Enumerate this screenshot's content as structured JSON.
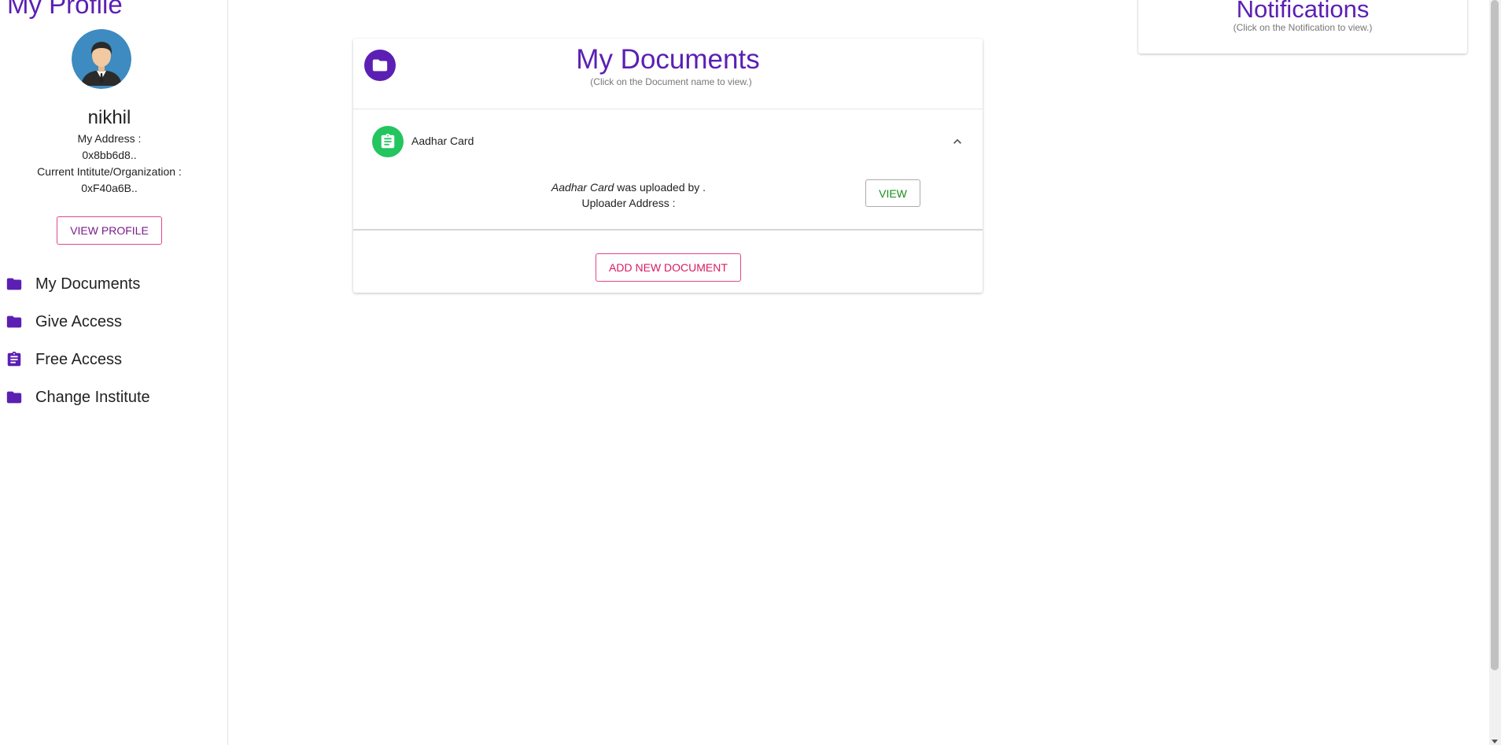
{
  "sidebar": {
    "title": "My Profile",
    "username": "nikhil",
    "address_label": "My Address :",
    "address_value": "0x8bb6d8..",
    "institute_label": "Current Intitute/Organization :",
    "institute_value": "0xF40a6B..",
    "view_profile_label": "VIEW PROFILE",
    "nav_items": [
      {
        "label": "My Documents",
        "icon": "folder-icon"
      },
      {
        "label": "Give Access",
        "icon": "folder-icon"
      },
      {
        "label": "Free Access",
        "icon": "clipboard-icon"
      },
      {
        "label": "Change Institute",
        "icon": "folder-icon"
      }
    ]
  },
  "main": {
    "title": "My Documents",
    "subtitle": "(Click on the Document name to view.)",
    "documents": [
      {
        "name": "Aadhar Card",
        "name_italic": "Aadhar Card",
        "uploaded_by_text": " was uploaded by .",
        "uploader_address_label": "Uploader Address :",
        "view_label": "VIEW"
      }
    ],
    "add_document_label": "ADD NEW DOCUMENT"
  },
  "notifications": {
    "title": "Notifications",
    "subtitle": "(Click on the Notification to view.)"
  },
  "colors": {
    "accent": "#5b1fb4",
    "document_icon": "#22c55e",
    "button_border": "#e0488b",
    "view_text": "#1a8f1a"
  }
}
